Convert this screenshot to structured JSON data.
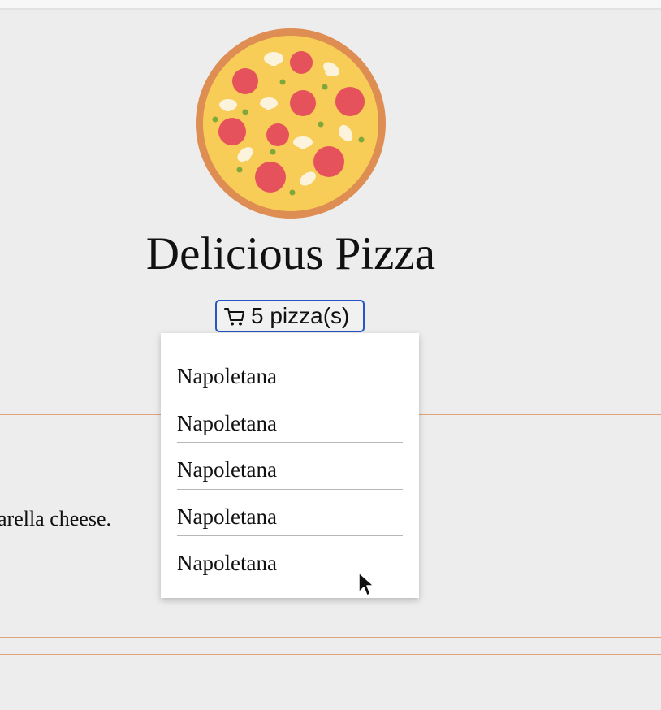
{
  "header": {
    "title": "Delicious Pizza",
    "logo_icon": "pizza-icon"
  },
  "cart": {
    "button_label": "5 pizza(s)",
    "icon": "cart-icon",
    "items": [
      {
        "name": "Napoletana"
      },
      {
        "name": "Napoletana"
      },
      {
        "name": "Napoletana"
      },
      {
        "name": "Napoletana"
      },
      {
        "name": "Napoletana"
      }
    ]
  },
  "content": {
    "partial_description": "arella cheese."
  },
  "colors": {
    "accent_border": "#2457c5",
    "divider": "#e0a47a",
    "background": "#ededed"
  }
}
